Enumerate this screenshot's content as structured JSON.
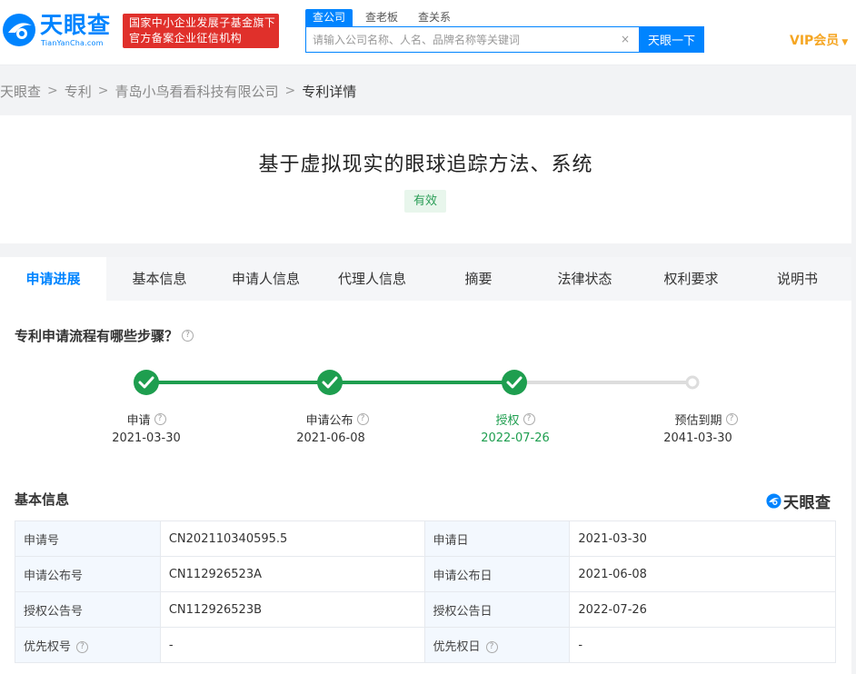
{
  "header": {
    "logo_cn": "天眼查",
    "logo_en": "TianYanCha.com",
    "badge_line1": "国家中小企业发展子基金旗下",
    "badge_line2": "官方备案企业征信机构",
    "search_tabs": [
      "查公司",
      "查老板",
      "查关系"
    ],
    "search_placeholder": "请输入公司名称、人名、品牌名称等关键词",
    "clear_label": "×",
    "search_button": "天眼一下",
    "vip_label": "VIP会员",
    "colors": {
      "brand": "#0084ff",
      "badge": "#e0302b",
      "vip": "#f5a623"
    }
  },
  "breadcrumb": [
    "天眼查",
    "专利",
    "青岛小鸟看看科技有限公司",
    "专利详情"
  ],
  "patent": {
    "title": "基于虚拟现实的眼球追踪方法、系统",
    "status": "有效"
  },
  "tabs": [
    "申请进展",
    "基本信息",
    "申请人信息",
    "代理人信息",
    "摘要",
    "法律状态",
    "权利要求",
    "说明书"
  ],
  "progress": {
    "question": "专利申请流程有哪些步骤？",
    "steps": [
      {
        "label": "申请",
        "date": "2021-03-30",
        "done": true
      },
      {
        "label": "申请公布",
        "date": "2021-06-08",
        "done": true
      },
      {
        "label": "授权",
        "date": "2022-07-26",
        "done": true
      },
      {
        "label": "预估到期",
        "date": "2041-03-30",
        "done": false
      }
    ],
    "colors": {
      "done": "#1e9e4f",
      "pending": "#dddddd"
    }
  },
  "basic_info": {
    "title": "基本信息",
    "watermark": "天眼查",
    "rows": [
      [
        {
          "k": "申请号",
          "v": "CN202110340595.5"
        },
        {
          "k": "申请日",
          "v": "2021-03-30"
        }
      ],
      [
        {
          "k": "申请公布号",
          "v": "CN112926523A"
        },
        {
          "k": "申请公布日",
          "v": "2021-06-08"
        }
      ],
      [
        {
          "k": "授权公告号",
          "v": "CN112926523B"
        },
        {
          "k": "授权公告日",
          "v": "2022-07-26"
        }
      ],
      [
        {
          "k": "优先权号",
          "v": "-",
          "help": true
        },
        {
          "k": "优先权日",
          "v": "-",
          "help": true
        }
      ]
    ]
  }
}
